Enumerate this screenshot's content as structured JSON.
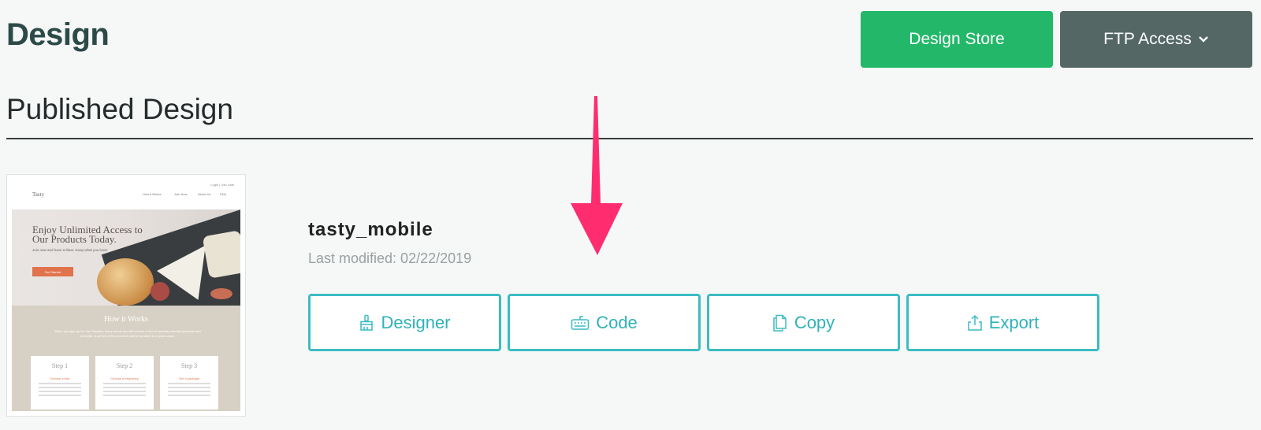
{
  "header": {
    "title": "Design",
    "design_store_label": "Design Store",
    "ftp_access_label": "FTP Access"
  },
  "section": {
    "title": "Published Design"
  },
  "design": {
    "name": "tasty_mobile",
    "modified": "Last modified: 02/22/2019"
  },
  "actions": [
    {
      "label": "Designer",
      "icon": "paintbrush-icon"
    },
    {
      "label": "Code",
      "icon": "keyboard-icon"
    },
    {
      "label": "Copy",
      "icon": "copy-icon"
    },
    {
      "label": "Export",
      "icon": "export-icon"
    }
  ],
  "thumbnail": {
    "logo": "Tasty",
    "top_links": "Login | Join Lists",
    "menu": [
      "How it Works",
      "Join Now",
      "About Us",
      "FAQ"
    ],
    "hero_heading_1": "Enjoy Unlimited Access to",
    "hero_heading_2": "Our Products Today.",
    "hero_sub": "Join now and have a blast. Keep what you love!",
    "cta": "Get Started",
    "how_title": "How it Works",
    "how_text": "When you sign up for The Sampler, every month you will receive a box of carefully selected products and presents. A portion of the proceeds will be donated to a good cause.",
    "steps": [
      {
        "title": "Step 1",
        "sub": "Choose a size"
      },
      {
        "title": "Step 2",
        "sub": "Choose a frequency"
      },
      {
        "title": "Step 3",
        "sub": "Get a package"
      }
    ]
  },
  "colors": {
    "primary_green": "#23b869",
    "ftp_gray": "#546765",
    "accent_teal": "#3cbcc3",
    "arrow_pink": "#ff2d6f"
  }
}
